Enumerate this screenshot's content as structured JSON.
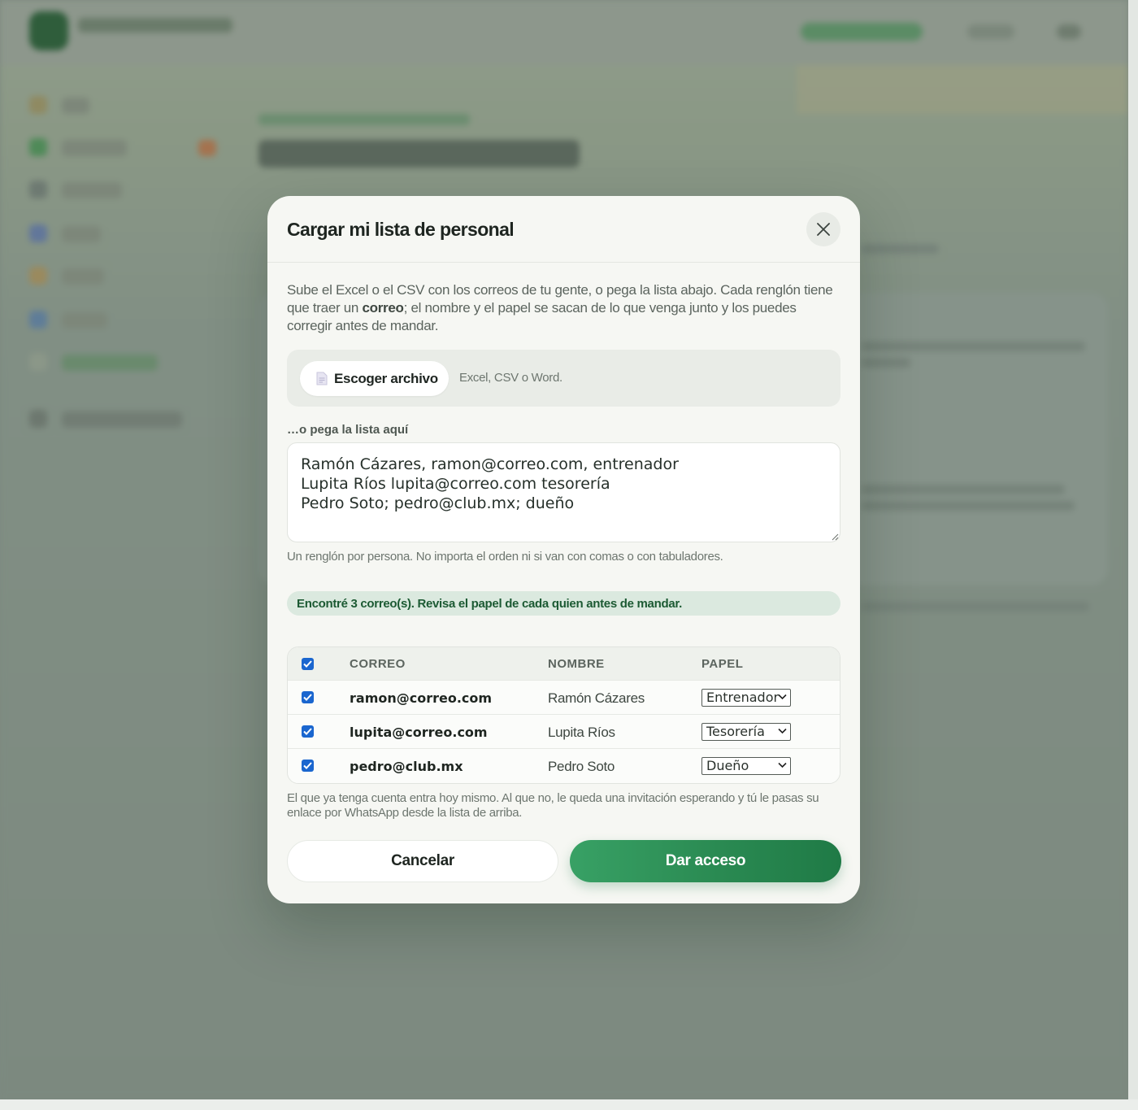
{
  "modal": {
    "title": "Cargar mi lista de personal",
    "intro_before": "Sube el Excel o el CSV con los correos de tu gente, o pega la lista abajo. Cada renglón tiene que traer un ",
    "intro_bold": "correo",
    "intro_after": "; el nombre y el papel se sacan de lo que venga junto y los puedes corregir antes de mandar.",
    "upload": {
      "button_label": "Escoger archivo",
      "hint": "Excel, CSV o Word."
    },
    "paste": {
      "label": "…o pega la lista aquí",
      "value": "Ramón Cázares, ramon@correo.com, entrenador\nLupita Ríos lupita@correo.com tesorería\nPedro Soto; pedro@club.mx; dueño",
      "hint": "Un renglón por persona. No importa el orden ni si van con comas o con tabuladores."
    },
    "found_banner": "Encontré 3 correo(s). Revisa el papel de cada quien antes de mandar.",
    "table": {
      "headers": {
        "email": "CORREO",
        "name": "NOMBRE",
        "role": "PAPEL"
      },
      "rows": [
        {
          "email": "ramon@correo.com",
          "name": "Ramón Cázares",
          "role": "Entrenador",
          "checked": true
        },
        {
          "email": "lupita@correo.com",
          "name": "Lupita Ríos",
          "role": "Tesorería",
          "checked": true
        },
        {
          "email": "pedro@club.mx",
          "name": "Pedro Soto",
          "role": "Dueño",
          "checked": true
        }
      ]
    },
    "footnote": "El que ya tenga cuenta entra hoy mismo. Al que no, le queda una invitación esperando y tú le pasas su enlace por WhatsApp desde la lista de arriba.",
    "actions": {
      "cancel": "Cancelar",
      "confirm": "Dar acceso"
    }
  },
  "colors": {
    "primary": "#2a8a52",
    "banner_bg": "#dbe9df",
    "banner_text": "#1c5a33",
    "checkbox": "#1a66cf"
  },
  "icons": {
    "close": "close-icon",
    "file": "document-icon",
    "checkbox": "check-icon",
    "select": "chevron-down-icon"
  }
}
